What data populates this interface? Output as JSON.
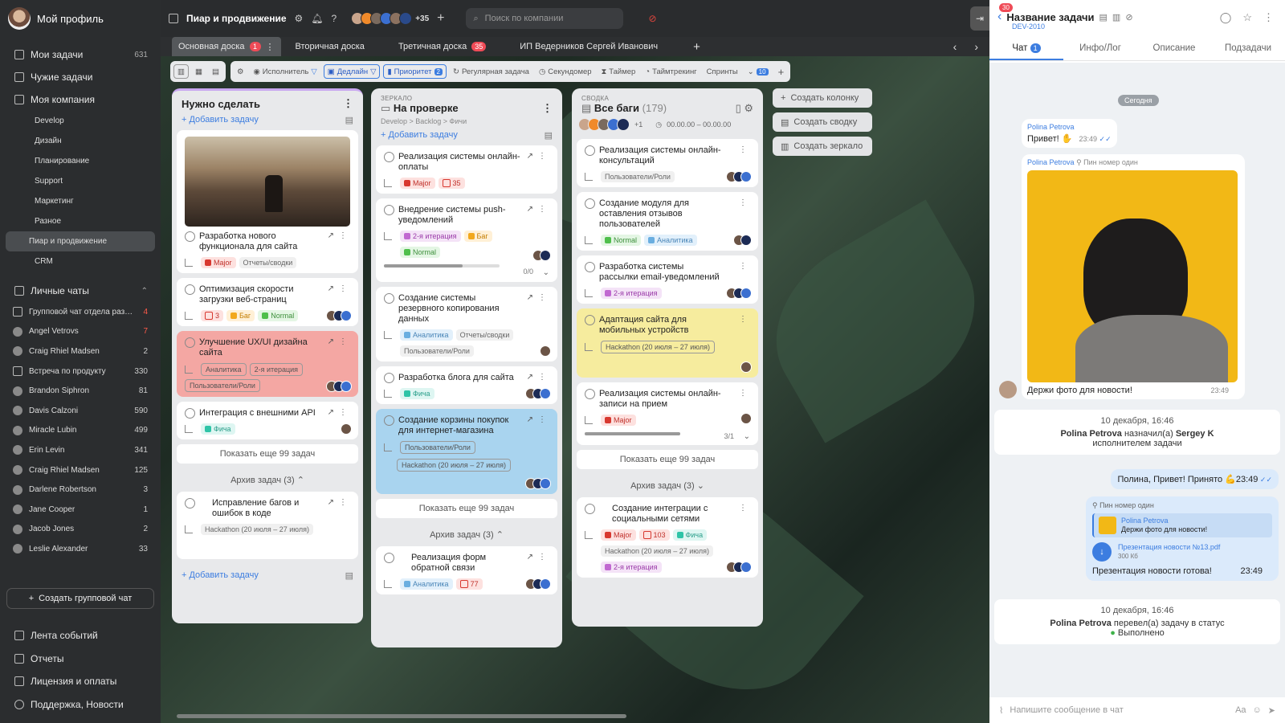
{
  "sidebar": {
    "profile": "Мой профиль",
    "nav": [
      {
        "label": "Мои задачи",
        "count": "631"
      },
      {
        "label": "Чужие задачи",
        "count": ""
      },
      {
        "label": "Моя компания",
        "count": ""
      }
    ],
    "company_items": [
      "Develop",
      "Дизайн",
      "Планирование",
      "Support",
      "Маркетинг",
      "Разное",
      "Пиар и продвижение",
      "CRM"
    ],
    "personal_chats_label": "Личные чаты",
    "chats": [
      {
        "label": "Групповой чат отдела разра...",
        "count": "4",
        "red": true
      },
      {
        "label": "Angel Vetrovs",
        "count": "7",
        "red": true
      },
      {
        "label": "Craig Rhiel Madsen",
        "count": "2"
      },
      {
        "label": "Встреча по продукту",
        "count": "330"
      },
      {
        "label": "Brandon Siphron",
        "count": "81"
      },
      {
        "label": "Davis Calzoni",
        "count": "590"
      },
      {
        "label": "Miracle Lubin",
        "count": "499"
      },
      {
        "label": "Erin Levin",
        "count": "341"
      },
      {
        "label": "Craig Rhiel Madsen",
        "count": "125"
      },
      {
        "label": "Darlene Robertson",
        "count": "3"
      },
      {
        "label": "Jane Cooper",
        "count": "1"
      },
      {
        "label": "Jacob Jones",
        "count": "2"
      },
      {
        "label": "Leslie Alexander",
        "count": "33"
      }
    ],
    "create_group": "Создать групповой чат",
    "bottom": [
      "Лента событий",
      "Отчеты",
      "Лицензия и оплаты",
      "Поддержка, Новости"
    ]
  },
  "topbar": {
    "title": "Пиар и продвижение",
    "avatars_more": "+35",
    "search_placeholder": "Поиск по компании"
  },
  "tabs": [
    {
      "label": "Основная доска",
      "badge": "1"
    },
    {
      "label": "Вторичная доска",
      "badge": ""
    },
    {
      "label": "Третичная доска",
      "badge": "35"
    },
    {
      "label": "ИП Ведерников Сергей Иванович",
      "badge": ""
    }
  ],
  "toolbar": {
    "filters": [
      "Исполнитель",
      "Дедлайн",
      "Приоритет",
      "Регулярная задача",
      "Секундомер",
      "Таймер",
      "Таймтрекинг",
      "Спринты"
    ],
    "priority_count": "2",
    "more_count": "10"
  },
  "columns": {
    "todo": {
      "title": "Нужно сделать",
      "add": "Добавить задачу",
      "cards": [
        {
          "title": "Разработка нового функционала для сайта",
          "tags": [
            "Major",
            "Отчеты/сводки"
          ]
        },
        {
          "title": "Оптимизация скорости загрузки веб-страниц",
          "tags": [
            "3",
            "Баг",
            "Normal"
          ]
        },
        {
          "title": "Улучшение UX/UI дизайна сайта",
          "tags": [
            "Аналитика",
            "2-я итерация",
            "Пользователи/Роли"
          ]
        },
        {
          "title": "Интеграция с внешними API",
          "tags": [
            "Фича"
          ]
        }
      ],
      "show_more": "Показать еще 99 задач",
      "archive": "Архив задач (3)",
      "archived_card": {
        "title": "Исправление багов и ошибок в коде",
        "tags": [
          "Hackathon (20 июля – 27 июля)"
        ]
      },
      "add_bottom": "Добавить задачу"
    },
    "review": {
      "kicker": "ЗЕРКАЛО",
      "title": "На проверке",
      "crumbs": "Develop  >  Backlog  >  Фичи",
      "add": "Добавить задачу",
      "cards": [
        {
          "title": "Реализация системы онлайн-оплаты",
          "tags": [
            "Major",
            "35"
          ]
        },
        {
          "title": "Внедрение системы push-уведомлений",
          "tags": [
            "2-я итерация",
            "Баг",
            "Normal"
          ],
          "progress": "0/0"
        },
        {
          "title": "Создание системы резервного копирования данных",
          "tags": [
            "Аналитика",
            "Отчеты/сводки",
            "Пользователи/Роли"
          ]
        },
        {
          "title": "Разработка блога для сайта",
          "tags": [
            "Фича"
          ]
        },
        {
          "title": "Создание корзины покупок для интернет-магазина",
          "tags": [
            "Пользователи/Роли",
            "Hackathon (20 июля – 27 июля)"
          ]
        }
      ],
      "show_more": "Показать еще 99 задач",
      "archive": "Архив задач (3)",
      "archived_card": {
        "title": "Реализация форм обратной связи",
        "tags": [
          "Аналитика",
          "77"
        ]
      }
    },
    "bugs": {
      "kicker": "СВОДКА",
      "title": "Все баги",
      "count": "(179)",
      "date_range": "00.00.00 – 00.00.00",
      "avatars_more": "+1",
      "cards": [
        {
          "title": "Реализация системы онлайн-консультаций",
          "tags": [
            "Пользователи/Роли"
          ]
        },
        {
          "title": "Создание модуля для оставления отзывов пользователей",
          "tags": [
            "Normal",
            "Аналитика"
          ]
        },
        {
          "title": "Разработка системы рассылки email-уведомлений",
          "tags": [
            "2-я итерация"
          ]
        },
        {
          "title": "Адаптация сайта для мобильных устройств",
          "tags": [
            "Hackathon (20 июля – 27 июля)"
          ]
        },
        {
          "title": "Реализация системы онлайн-записи на прием",
          "tags": [
            "Major"
          ],
          "progress": "3/1"
        }
      ],
      "show_more": "Показать еще 99 задач",
      "archive": "Архив задач (3)",
      "archived_card": {
        "title": "Создание интеграции с социальными сетями",
        "tags": [
          "Major",
          "103",
          "Фича",
          "Hackathon (20 июля – 27 июля)",
          "2-я итерация"
        ]
      }
    }
  },
  "actions": [
    "Создать колонку",
    "Создать сводку",
    "Создать зеркало"
  ],
  "right_panel": {
    "badge": "30",
    "title": "Название задачи",
    "code": "DEV-2010",
    "tabs": [
      "Чат",
      "Инфо/Лог",
      "Описание",
      "Подзадачи"
    ],
    "chat_badge": "1",
    "today": "Сегодня",
    "msg1": {
      "who": "Polina Petrova",
      "text": "Привет! ✋",
      "time": "23:49"
    },
    "msg2": {
      "who": "Polina Petrova",
      "pin": "Пин номер один",
      "text": "Держи фото для новости!",
      "time": "23:49"
    },
    "sys1": {
      "date": "10 декабря, 16:46",
      "actor": "Polina Petrova",
      "action": "назначил(а)",
      "target": "Sergey K",
      "role": "исполнителем задачи"
    },
    "reply1": {
      "text": "Полина, Привет! Принято 💪",
      "time": "23:49"
    },
    "reply2": {
      "pin": "Пин номер один",
      "quote_who": "Polina Petrova",
      "quote_text": "Держи фото для новости!",
      "file": "Презентация новости №13.pdf",
      "size": "300 Кб",
      "text": "Презентация новости готова!",
      "time": "23:49"
    },
    "sys2": {
      "date": "10 декабря, 16:46",
      "actor": "Polina Petrova",
      "action": "перевел(а) задачу в статус",
      "status": "Выполнено"
    },
    "input_placeholder": "Напишите сообщение в чат"
  }
}
